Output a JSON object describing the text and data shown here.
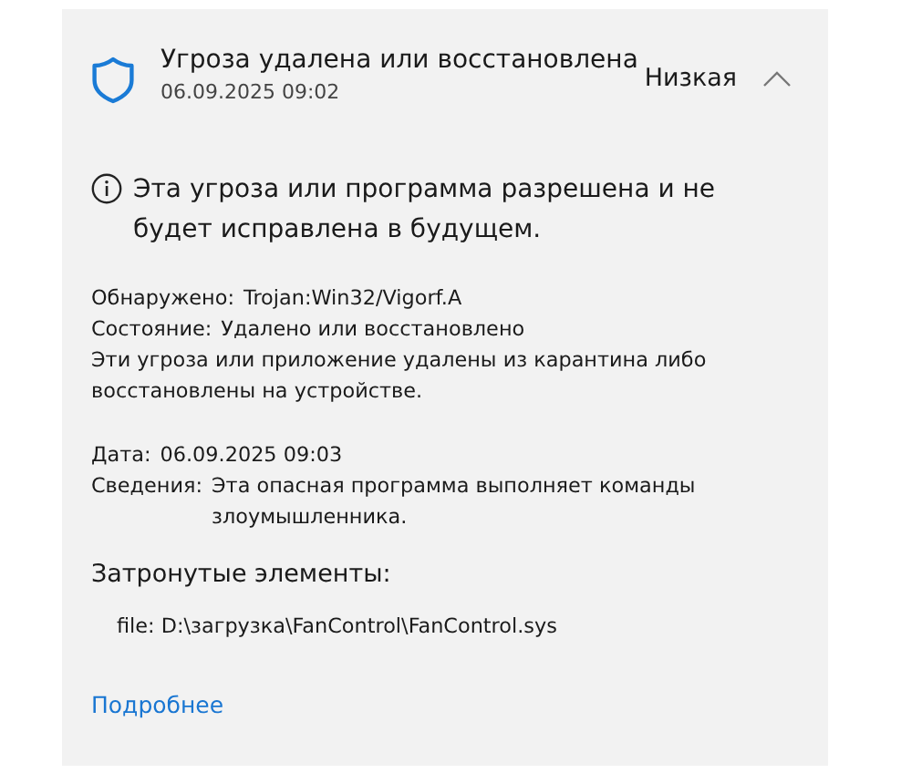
{
  "threat": {
    "title": "Угроза удалена или восстановлена",
    "timestamp": "06.09.2025 09:02",
    "severity": "Низкая",
    "expanded": true
  },
  "notice": "Эта угроза или программа разрешена и не будет исправлена в будущем.",
  "details": [
    {
      "kind": "field",
      "label": "Обнаружено:",
      "value": "Trojan:Win32/Vigorf.A"
    },
    {
      "kind": "field",
      "label": "Состояние:",
      "value": "Удалено или восстановлено"
    },
    {
      "kind": "note",
      "text": "Эти угроза или приложение удалены из карантина либо восстановлены на устройстве."
    }
  ],
  "details2": [
    {
      "kind": "field",
      "label": "Дата:",
      "value": "06.09.2025 09:03"
    },
    {
      "kind": "field",
      "label": "Сведения:",
      "value": "Эта опасная программа выполняет команды злоумышленника."
    }
  ],
  "affected": {
    "heading": "Затронутые элементы:",
    "items": [
      "file: D:\\загрузка\\FanControl\\FanControl.sys"
    ]
  },
  "link": "Подробнее"
}
